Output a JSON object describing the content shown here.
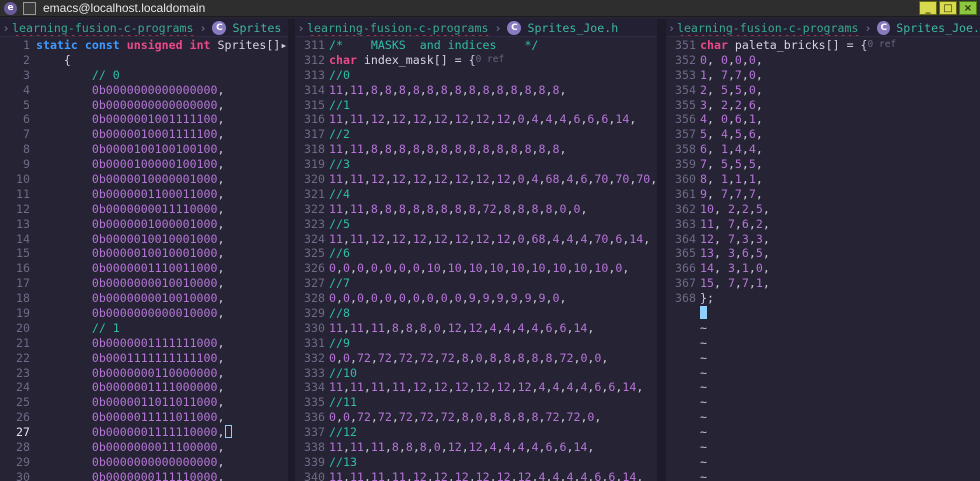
{
  "window": {
    "title": "emacs@localhost.localdomain",
    "app_icon": "e",
    "buttons": [
      "_",
      "□",
      "×"
    ]
  },
  "panes": [
    {
      "project": "learning-fusion-c-programs",
      "file": "Sprites",
      "lines": [
        {
          "n": "1",
          "t": "static const unsigned int Sprites[]"
        },
        {
          "n": "2",
          "t": "    {"
        },
        {
          "n": "3",
          "t": "        // 0"
        },
        {
          "n": "4",
          "t": "        0b0000000000000000,"
        },
        {
          "n": "5",
          "t": "        0b0000000000000000,"
        },
        {
          "n": "6",
          "t": "        0b0000001001111100,"
        },
        {
          "n": "7",
          "t": "        0b0000010001111100,"
        },
        {
          "n": "8",
          "t": "        0b0000100100100100,"
        },
        {
          "n": "9",
          "t": "        0b0000100000100100,"
        },
        {
          "n": "10",
          "t": "        0b0000010000001000,"
        },
        {
          "n": "11",
          "t": "        0b0000001100011000,"
        },
        {
          "n": "12",
          "t": "        0b0000000011110000,"
        },
        {
          "n": "13",
          "t": "        0b0000001000001000,"
        },
        {
          "n": "14",
          "t": "        0b0000010010001000,"
        },
        {
          "n": "15",
          "t": "        0b0000010010001000,"
        },
        {
          "n": "16",
          "t": "        0b0000001110011000,"
        },
        {
          "n": "17",
          "t": "        0b0000000010010000,"
        },
        {
          "n": "18",
          "t": "        0b0000000010010000,"
        },
        {
          "n": "19",
          "t": "        0b0000000000010000,"
        },
        {
          "n": "20",
          "t": "        // 1"
        },
        {
          "n": "21",
          "t": "        0b0000001111111000,"
        },
        {
          "n": "22",
          "t": "        0b0001111111111100,"
        },
        {
          "n": "23",
          "t": "        0b0000000110000000,"
        },
        {
          "n": "24",
          "t": "        0b0000001111000000,"
        },
        {
          "n": "25",
          "t": "        0b0000011011011000,"
        },
        {
          "n": "26",
          "t": "        0b0000011111011000,"
        },
        {
          "n": "27",
          "t": "        0b0000001111110000,"
        },
        {
          "n": "28",
          "t": "        0b0000000011100000,"
        },
        {
          "n": "29",
          "t": "        0b0000000000000000,"
        },
        {
          "n": "30",
          "t": "        0b0000000111110000,"
        }
      ]
    },
    {
      "project": "learning-fusion-c-programs",
      "file": "Sprites_Joe.h",
      "lines": [
        {
          "n": "311",
          "t": "/*    MASKS  and indices    */"
        },
        {
          "n": "312",
          "t": "char index_mask[] = {",
          "ref": "0 ref"
        },
        {
          "n": "313",
          "t": "//0"
        },
        {
          "n": "314",
          "t": "11,11,8,8,8,8,8,8,8,8,8,8,8,8,8,8,"
        },
        {
          "n": "315",
          "t": "//1"
        },
        {
          "n": "316",
          "t": "11,11,12,12,12,12,12,12,12,0,4,4,4,6,6,6,14,"
        },
        {
          "n": "317",
          "t": "//2"
        },
        {
          "n": "318",
          "t": "11,11,8,8,8,8,8,8,8,8,8,8,8,8,8,8,"
        },
        {
          "n": "319",
          "t": "//3"
        },
        {
          "n": "320",
          "t": "11,11,12,12,12,12,12,12,12,0,4,68,4,6,70,70,70,"
        },
        {
          "n": "321",
          "t": "//4"
        },
        {
          "n": "322",
          "t": "11,11,8,8,8,8,8,8,8,8,72,8,8,8,8,0,0,"
        },
        {
          "n": "323",
          "t": "//5"
        },
        {
          "n": "324",
          "t": "11,11,12,12,12,12,12,12,12,0,68,4,4,4,70,6,14,"
        },
        {
          "n": "325",
          "t": "//6"
        },
        {
          "n": "326",
          "t": "0,0,0,0,0,0,0,10,10,10,10,10,10,10,10,10,0,"
        },
        {
          "n": "327",
          "t": "//7"
        },
        {
          "n": "328",
          "t": "0,0,0,0,0,0,0,0,0,0,9,9,9,9,9,9,0,"
        },
        {
          "n": "329",
          "t": "//8"
        },
        {
          "n": "330",
          "t": "11,11,11,8,8,8,0,12,12,4,4,4,4,6,6,14,"
        },
        {
          "n": "331",
          "t": "//9"
        },
        {
          "n": "332",
          "t": "0,0,72,72,72,72,72,8,0,8,8,8,8,8,72,0,0,"
        },
        {
          "n": "333",
          "t": "//10"
        },
        {
          "n": "334",
          "t": "11,11,11,11,12,12,12,12,12,12,4,4,4,4,6,6,14,"
        },
        {
          "n": "335",
          "t": "//11"
        },
        {
          "n": "336",
          "t": "0,0,72,72,72,72,72,8,0,8,8,8,8,72,72,0,"
        },
        {
          "n": "337",
          "t": "//12"
        },
        {
          "n": "338",
          "t": "11,11,11,8,8,8,0,12,12,4,4,4,4,6,6,14,"
        },
        {
          "n": "339",
          "t": "//13"
        },
        {
          "n": "340",
          "t": "11,11,11,11,12,12,12,12,12,12,4,4,4,4,6,6,14,"
        }
      ]
    },
    {
      "project": "learning-fusion-c-programs",
      "file": "Sprites_Joe.",
      "lines": [
        {
          "n": "351",
          "t": "char paleta_bricks[] = {",
          "ref": "0 ref"
        },
        {
          "n": "352",
          "t": "0, 0,0,0,"
        },
        {
          "n": "353",
          "t": "1, 7,7,0,"
        },
        {
          "n": "354",
          "t": "2, 5,5,0,"
        },
        {
          "n": "355",
          "t": "3, 2,2,6,"
        },
        {
          "n": "356",
          "t": "4, 0,6,1,"
        },
        {
          "n": "357",
          "t": "5, 4,5,6,"
        },
        {
          "n": "358",
          "t": "6, 1,4,4,"
        },
        {
          "n": "359",
          "t": "7, 5,5,5,"
        },
        {
          "n": "360",
          "t": "8, 1,1,1,"
        },
        {
          "n": "361",
          "t": "9, 7,7,7,"
        },
        {
          "n": "362",
          "t": "10, 2,2,5,"
        },
        {
          "n": "363",
          "t": "11, 7,6,2,"
        },
        {
          "n": "364",
          "t": "12, 7,3,3,"
        },
        {
          "n": "365",
          "t": "13, 3,6,5,"
        },
        {
          "n": "366",
          "t": "14, 3,1,0,"
        },
        {
          "n": "367",
          "t": "15, 7,7,1,"
        },
        {
          "n": "368",
          "t": "};"
        }
      ]
    }
  ],
  "tilde": "~",
  "current_line": "27"
}
